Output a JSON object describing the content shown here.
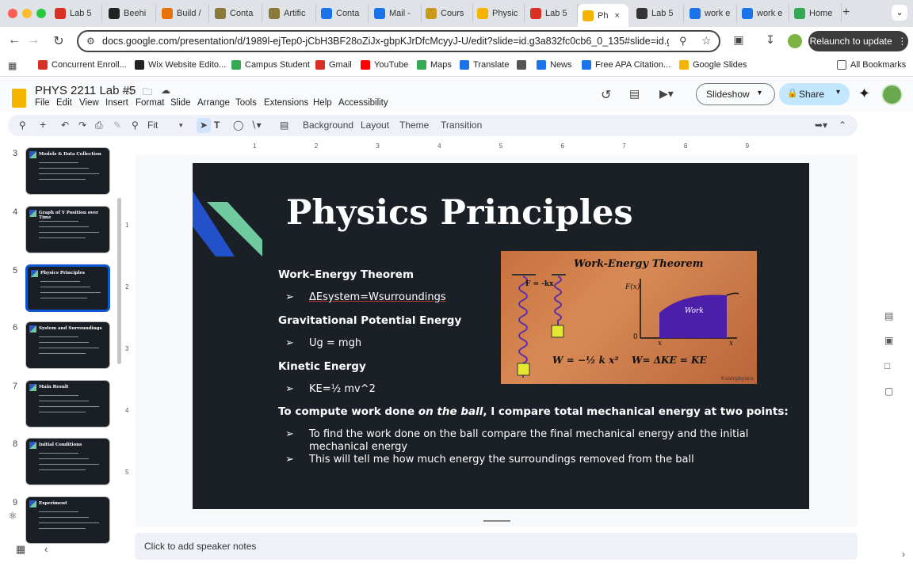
{
  "browser": {
    "tabs": [
      {
        "label": "Lab 5",
        "color": "#d93025"
      },
      {
        "label": "Beehi",
        "color": "#222222"
      },
      {
        "label": "Build /",
        "color": "#e8710a"
      },
      {
        "label": "Conta",
        "color": "#8a7a3a"
      },
      {
        "label": "Artific",
        "color": "#8a7a3a"
      },
      {
        "label": "Conta",
        "color": "#1a73e8"
      },
      {
        "label": "Mail -",
        "color": "#1a73e8"
      },
      {
        "label": "Cours",
        "color": "#c99a1a"
      },
      {
        "label": "Physic",
        "color": "#f4b400"
      },
      {
        "label": "Lab 5",
        "color": "#d93025"
      },
      {
        "label": "Ph",
        "color": "#f4b400",
        "active": true
      },
      {
        "label": "Lab 5",
        "color": "#333333"
      },
      {
        "label": "work e",
        "color": "#1a73e8"
      },
      {
        "label": "work e",
        "color": "#1a73e8"
      },
      {
        "label": "Home",
        "color": "#34a853"
      }
    ],
    "url": "docs.google.com/presentation/d/1989l-ejTep0-jCbH3BF28oZiJx-gbpKJrDfcMcyyJ-U/edit?slide=id.g3a832fc0cb6_0_135#slide=id.g3a...",
    "relaunch_label": "Relaunch to update",
    "bookmarks": [
      {
        "label": "Concurrent Enroll...",
        "color": "#d93025"
      },
      {
        "label": "Wix Website Edito...",
        "color": "#222222"
      },
      {
        "label": "Campus Student",
        "color": "#34a853"
      },
      {
        "label": "Gmail",
        "color": "#d93025"
      },
      {
        "label": "YouTube",
        "color": "#ff0000"
      },
      {
        "label": "Maps",
        "color": "#34a853"
      },
      {
        "label": "Translate",
        "color": "#1a73e8"
      },
      {
        "label": "",
        "color": "#555555"
      },
      {
        "label": "News",
        "color": "#1a73e8"
      },
      {
        "label": "Free APA Citation...",
        "color": "#1a73e8"
      },
      {
        "label": "Google Slides",
        "color": "#f4b400"
      }
    ],
    "all_bookmarks": "All Bookmarks"
  },
  "doc": {
    "title": "PHYS 2211 Lab #5",
    "menu": [
      "File",
      "Edit",
      "View",
      "Insert",
      "Format",
      "Slide",
      "Arrange",
      "Tools",
      "Extensions",
      "Help",
      "Accessibility"
    ],
    "slideshow_label": "Slideshow",
    "share_label": "Share"
  },
  "toolbar": {
    "zoom": "Fit",
    "background": "Background",
    "layout": "Layout",
    "theme": "Theme",
    "transition": "Transition"
  },
  "ruler": {
    "h": [
      "1",
      "2",
      "3",
      "4",
      "5",
      "6",
      "7",
      "8",
      "9"
    ],
    "v": [
      "1",
      "2",
      "3",
      "4",
      "5"
    ]
  },
  "filmstrip": [
    {
      "num": "3",
      "title": "Models & Data Collection"
    },
    {
      "num": "4",
      "title": "Graph of Y Position over Time"
    },
    {
      "num": "5",
      "title": "Physics Principles",
      "selected": true
    },
    {
      "num": "6",
      "title": "System and Surroundings"
    },
    {
      "num": "7",
      "title": "Main Result"
    },
    {
      "num": "8",
      "title": "Initial Conditions"
    },
    {
      "num": "9",
      "title": "Experiment"
    }
  ],
  "slide": {
    "title": "Physics Principles",
    "h1": "Work–Energy Theorem",
    "b1": "ΔEsystem=Wsurroundings",
    "h2": "Gravitational Potential Energy",
    "b2": "Ug = mgh",
    "h3": "Kinetic Energy",
    "b3": "KE=½ mv^2",
    "p_pre": "To compute work done ",
    "p_em": "on the ball",
    "p_post": ", I compare total mechanical energy at two points:",
    "b4a": "To find the work done on the ball compare the final mechanical energy and the initial",
    "b4b": "mechanical energy",
    "b5": "This will tell me how much energy the surroundings removed from the ball",
    "bullet": "➢",
    "figure": {
      "title": "Work-Energy Theorem",
      "spring_label": "F = -kx",
      "fx": "F(x)",
      "work": "Work",
      "zero": "0",
      "x1": "x",
      "x2": "x",
      "formula1": "W = −½ k x²",
      "formula2": "W",
      "formula3": "= ΔKE = KE",
      "credit": "©univphysics"
    }
  },
  "notes_placeholder": "Click to add speaker notes"
}
